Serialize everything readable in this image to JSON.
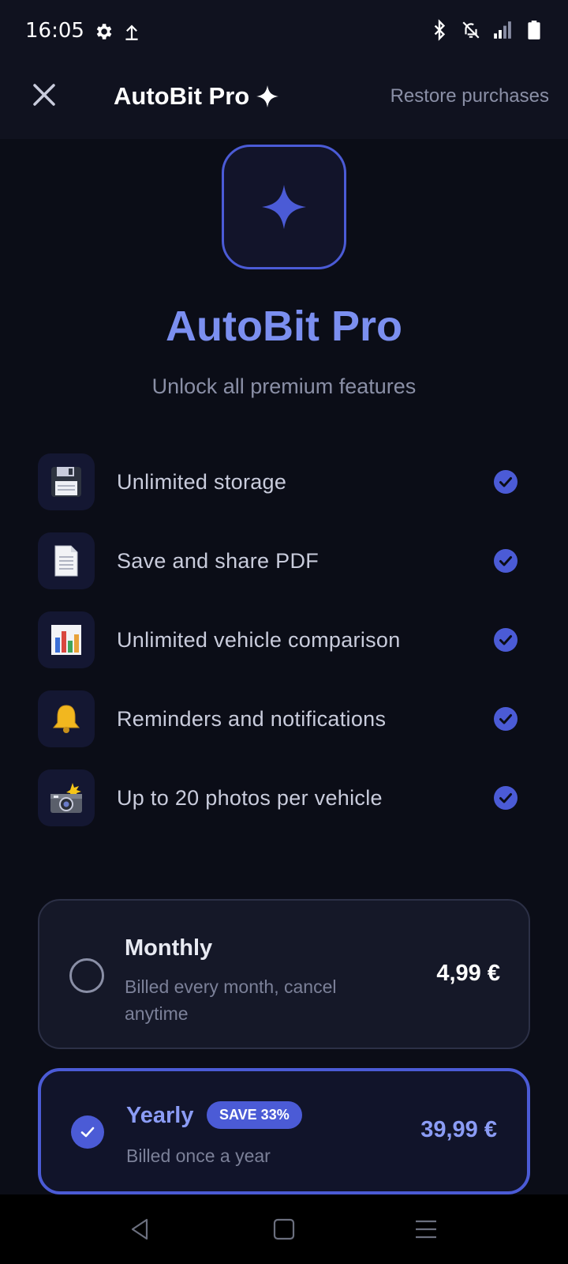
{
  "status_bar": {
    "time": "16:05",
    "left_icons": [
      "gear-icon",
      "upload-icon"
    ],
    "right_icons": [
      "bluetooth-icon",
      "notifications-off-icon",
      "signal-icon",
      "battery-icon"
    ]
  },
  "app_bar": {
    "title": "AutoBit Pro",
    "title_icon": "sparkle-icon",
    "restore_label": "Restore purchases"
  },
  "hero": {
    "icon": "sparkle-icon",
    "title": "AutoBit Pro",
    "subtitle": "Unlock all premium features"
  },
  "features": [
    {
      "icon": "floppy-disk-icon",
      "label": "Unlimited storage",
      "checked": true
    },
    {
      "icon": "document-icon",
      "label": "Save and share PDF",
      "checked": true
    },
    {
      "icon": "bar-chart-icon",
      "label": "Unlimited vehicle comparison",
      "checked": true
    },
    {
      "icon": "bell-icon",
      "label": "Reminders and notifications",
      "checked": true
    },
    {
      "icon": "camera-flash-icon",
      "label": "Up to 20 photos per vehicle",
      "checked": true
    }
  ],
  "plans": {
    "monthly": {
      "name": "Monthly",
      "description": "Billed every month, cancel anytime",
      "price": "4,99 €",
      "selected": false
    },
    "yearly": {
      "name": "Yearly",
      "badge": "SAVE 33%",
      "description": "Billed once a year",
      "price": "39,99 €",
      "selected": true
    }
  },
  "nav_bar": {
    "buttons": [
      "back-icon",
      "home-icon",
      "menu-icon"
    ]
  },
  "colors": {
    "accent": "#4b5bd6",
    "accent_text": "#7b8ff0",
    "background": "#0b0d17"
  }
}
